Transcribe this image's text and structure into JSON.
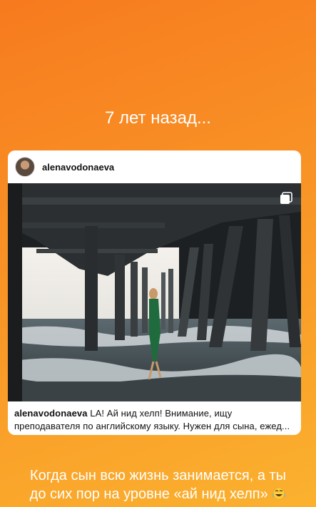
{
  "story": {
    "title": "7 лет назад..."
  },
  "post": {
    "username": "alenavodonaeva",
    "caption_user": "alenavodonaeva",
    "caption_line1": " LA! Ай нид хелп! Внимание, ищу",
    "caption_line2": "преподавателя по английскому языку. Нужен для сына, ежед...",
    "icons": {
      "avatar": "profile-photo",
      "multi": "multiple-photos-icon"
    }
  },
  "overlay": {
    "line1": "Когда сын всю жизнь занимается, а ты",
    "line2": "до сих пор на уровне «ай нид хелп»",
    "emoji": "crying-laughing-emoji"
  },
  "colors": {
    "gradient_top": "#f77a1e",
    "gradient_bottom": "#fbb12e"
  }
}
